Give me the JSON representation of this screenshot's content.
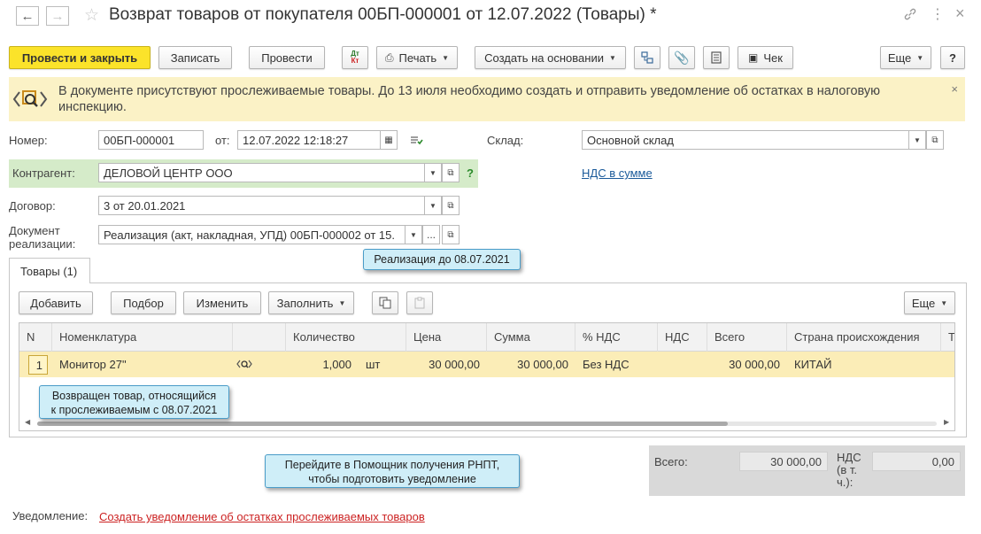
{
  "window": {
    "title": "Возврат товаров от покупателя 00БП-000001 от 12.07.2022 (Товары) *"
  },
  "toolbar": {
    "post_and_close": "Провести и закрыть",
    "save": "Записать",
    "post": "Провести",
    "dt_kt_top": "Дт",
    "dt_kt_bottom": "Кт",
    "print": "Печать",
    "create_based_on": "Создать на основании",
    "receipt": "Чек",
    "more": "Еще",
    "help": "?"
  },
  "notice": {
    "text": "В документе присутствуют прослеживаемые товары. До 13 июля необходимо создать и отправить уведомление об остатках в налоговую инспекцию.",
    "close": "×"
  },
  "form": {
    "number_label": "Номер:",
    "number_value": "00БП-000001",
    "date_label": "от:",
    "date_value": "12.07.2022 12:18:27",
    "warehouse_label": "Склад:",
    "warehouse_value": "Основной склад",
    "counterparty_label": "Контрагент:",
    "counterparty_value": "ДЕЛОВОЙ ЦЕНТР ООО",
    "counterparty_help": "?",
    "vat_link": "НДС в сумме",
    "contract_label": "Договор:",
    "contract_value": "3 от 20.01.2021",
    "sales_doc_label_1": "Документ",
    "sales_doc_label_2": "реализации:",
    "sales_doc_value": "Реализация (акт, накладная, УПД) 00БП-000002 от 15.",
    "sales_doc_dots": "..."
  },
  "tabs": [
    {
      "label": "Товары (1)"
    }
  ],
  "table_toolbar": {
    "add": "Добавить",
    "pick": "Подбор",
    "edit": "Изменить",
    "fill": "Заполнить",
    "more": "Еще"
  },
  "table": {
    "columns": [
      "N",
      "Номенклатура",
      "",
      "Количество",
      "Цена",
      "Сумма",
      "% НДС",
      "НДС",
      "Всего",
      "Страна происхождения",
      "Т"
    ],
    "rows": [
      {
        "n": "1",
        "item": "Монитор 27\"",
        "qty": "1,000",
        "unit": "шт",
        "price": "30 000,00",
        "sum": "30 000,00",
        "vat_rate": "Без НДС",
        "vat": "",
        "total": "30 000,00",
        "country": "КИТАЙ"
      }
    ]
  },
  "totals": {
    "total_label": "Всего:",
    "total_value": "30 000,00",
    "vat_label_1": "НДС",
    "vat_label_2": "(в т.",
    "vat_label_3": "ч.):",
    "vat_value": "0,00"
  },
  "footer": {
    "notification_label": "Уведомление:",
    "notification_link": "Создать уведомление об остатках прослеживаемых товаров"
  },
  "callouts": {
    "sales_date": "Реализация до 08.07.2021",
    "returned_1": "Возвращен товар, относящийся",
    "returned_2": "к прослеживаемым с 08.07.2021",
    "assistant_1": "Перейдите в Помощник получения РНПТ,",
    "assistant_2": "чтобы подготовить уведомление"
  },
  "colors": {
    "primary_button": "#fbe32a",
    "notice_bg": "#fbf2c6",
    "counterparty_bg": "#d5ebc9",
    "selected_row": "#fbedb7",
    "link": "#1a5a9a",
    "red_link": "#cc2222",
    "callout_bg": "#cfeef8"
  }
}
